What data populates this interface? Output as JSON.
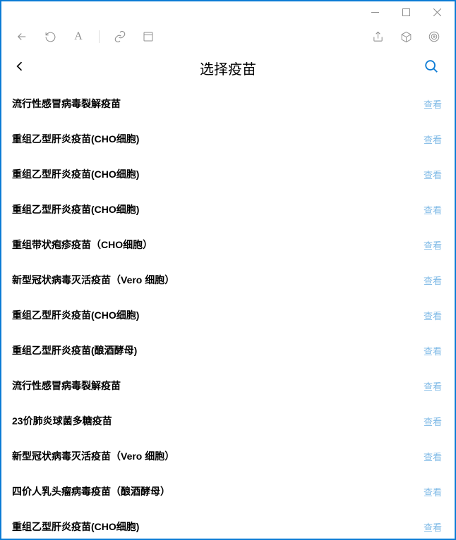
{
  "window_controls": {
    "minimize": "—",
    "maximize": "☐",
    "close": "✕"
  },
  "toolbar": {
    "back": "back-icon",
    "refresh": "refresh-icon",
    "font": "A",
    "link": "link-icon",
    "board": "panel-icon",
    "share": "share-icon",
    "cube": "box-icon",
    "target": "target-icon"
  },
  "header": {
    "title": "选择疫苗",
    "back": "back",
    "search": "search"
  },
  "view_label": "查看",
  "vaccines": [
    {
      "name": "流行性感冒病毒裂解疫苗"
    },
    {
      "name": "重组乙型肝炎疫苗(CHO细胞)"
    },
    {
      "name": "重组乙型肝炎疫苗(CHO细胞)"
    },
    {
      "name": "重组乙型肝炎疫苗(CHO细胞)"
    },
    {
      "name": "重组带状疱疹疫苗（CHO细胞）"
    },
    {
      "name": "新型冠状病毒灭活疫苗（Vero 细胞）"
    },
    {
      "name": "重组乙型肝炎疫苗(CHO细胞)"
    },
    {
      "name": "重组乙型肝炎疫苗(酿酒酵母)"
    },
    {
      "name": "流行性感冒病毒裂解疫苗"
    },
    {
      "name": "23价肺炎球菌多糖疫苗"
    },
    {
      "name": "新型冠状病毒灭活疫苗（Vero 细胞）"
    },
    {
      "name": "四价人乳头瘤病毒疫苗（酿酒酵母）"
    },
    {
      "name": "重组乙型肝炎疫苗(CHO细胞)"
    }
  ],
  "colors": {
    "accent": "#0b7bd5",
    "link": "#7eb9e6",
    "icon": "#8f8f8f"
  }
}
